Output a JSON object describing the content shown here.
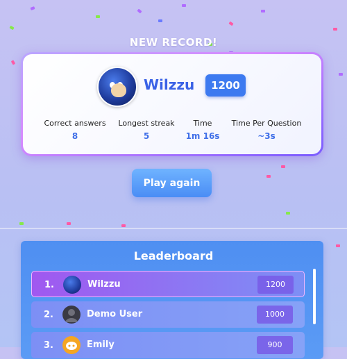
{
  "header": {
    "new_record": "NEW RECORD!"
  },
  "player": {
    "name": "Wilzzu",
    "score": "1200",
    "avatar_icon": "sonic-avatar-icon"
  },
  "stats": [
    {
      "label": "Correct answers",
      "value": "8"
    },
    {
      "label": "Longest streak",
      "value": "5"
    },
    {
      "label": "Time",
      "value": "1m 16s"
    },
    {
      "label": "Time Per Question",
      "value": "~3s"
    }
  ],
  "actions": {
    "play_again": "Play again"
  },
  "leaderboard": {
    "title": "Leaderboard",
    "rows": [
      {
        "rank": "1.",
        "name": "Wilzzu",
        "points": "1200",
        "avatar_icon": "sonic-avatar-icon"
      },
      {
        "rank": "2.",
        "name": "Demo User",
        "points": "1000",
        "avatar_icon": "default-user-icon"
      },
      {
        "rank": "3.",
        "name": "Emily",
        "points": "900",
        "avatar_icon": "discord-avatar-icon"
      }
    ]
  },
  "colors": {
    "accent": "#3d7af0",
    "card_border": "#c08cff",
    "leaderboard_bg": "#4f8ff2",
    "highlight_row": "#9a5cf0"
  }
}
